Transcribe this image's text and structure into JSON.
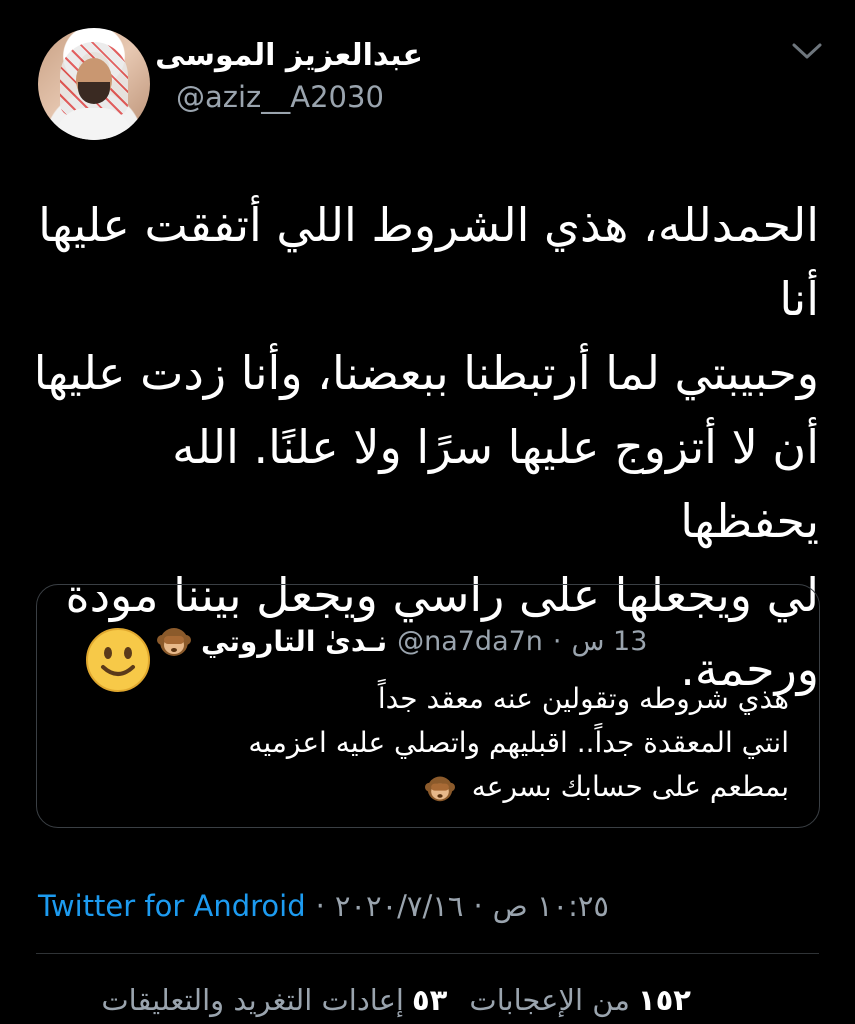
{
  "author": {
    "display_name": "عبدالعزيز الموسى",
    "handle": "@aziz__A2030",
    "avatar_icon": "user-avatar"
  },
  "menu_icon": "chevron-down-icon",
  "tweet": {
    "lines": [
      "الحمدلله، هذي الشروط اللي أتفقت عليها أنا",
      "وحبيبتي لما أرتبطنا ببعضنا، وأنا زدت عليها",
      "أن لا أتزوج عليها سرًا ولا علنًا. الله يحفظها",
      "لي ويجعلها على راسي ويجعل بيننا مودة",
      "ورحمة."
    ]
  },
  "quoted_tweet": {
    "display_name": "نـدىٰ التاروتي",
    "handle": "@na7da7n",
    "separator": "·",
    "time": "13 س",
    "lines": [
      "هذي شروطه وتقولين عنه معقد جداً",
      "انتي المعقدة جداً.. اقبليهم واتصلي عليه اعزميه",
      "بمطعم على حسابك بسرعه"
    ],
    "name_icon": "see-no-evil-monkey-icon",
    "text_icon": "see-no-evil-monkey-icon",
    "media_icon": "smiley-face-icon"
  },
  "meta": {
    "time": "١٠:٢٥ ص",
    "date": "٢٠٢٠/٧/١٦",
    "separator": "·",
    "source": "Twitter for Android"
  },
  "stats": {
    "retweets_count": "٥٣",
    "retweets_label": "إعادات التغريد والتعليقات",
    "likes_count": "١٥٢",
    "likes_label": "من الإعجابات"
  },
  "colors": {
    "background": "#000000",
    "text": "#ffffff",
    "secondary_text": "#9aa4ae",
    "link": "#1d9bf0",
    "border": "#2f3336"
  }
}
